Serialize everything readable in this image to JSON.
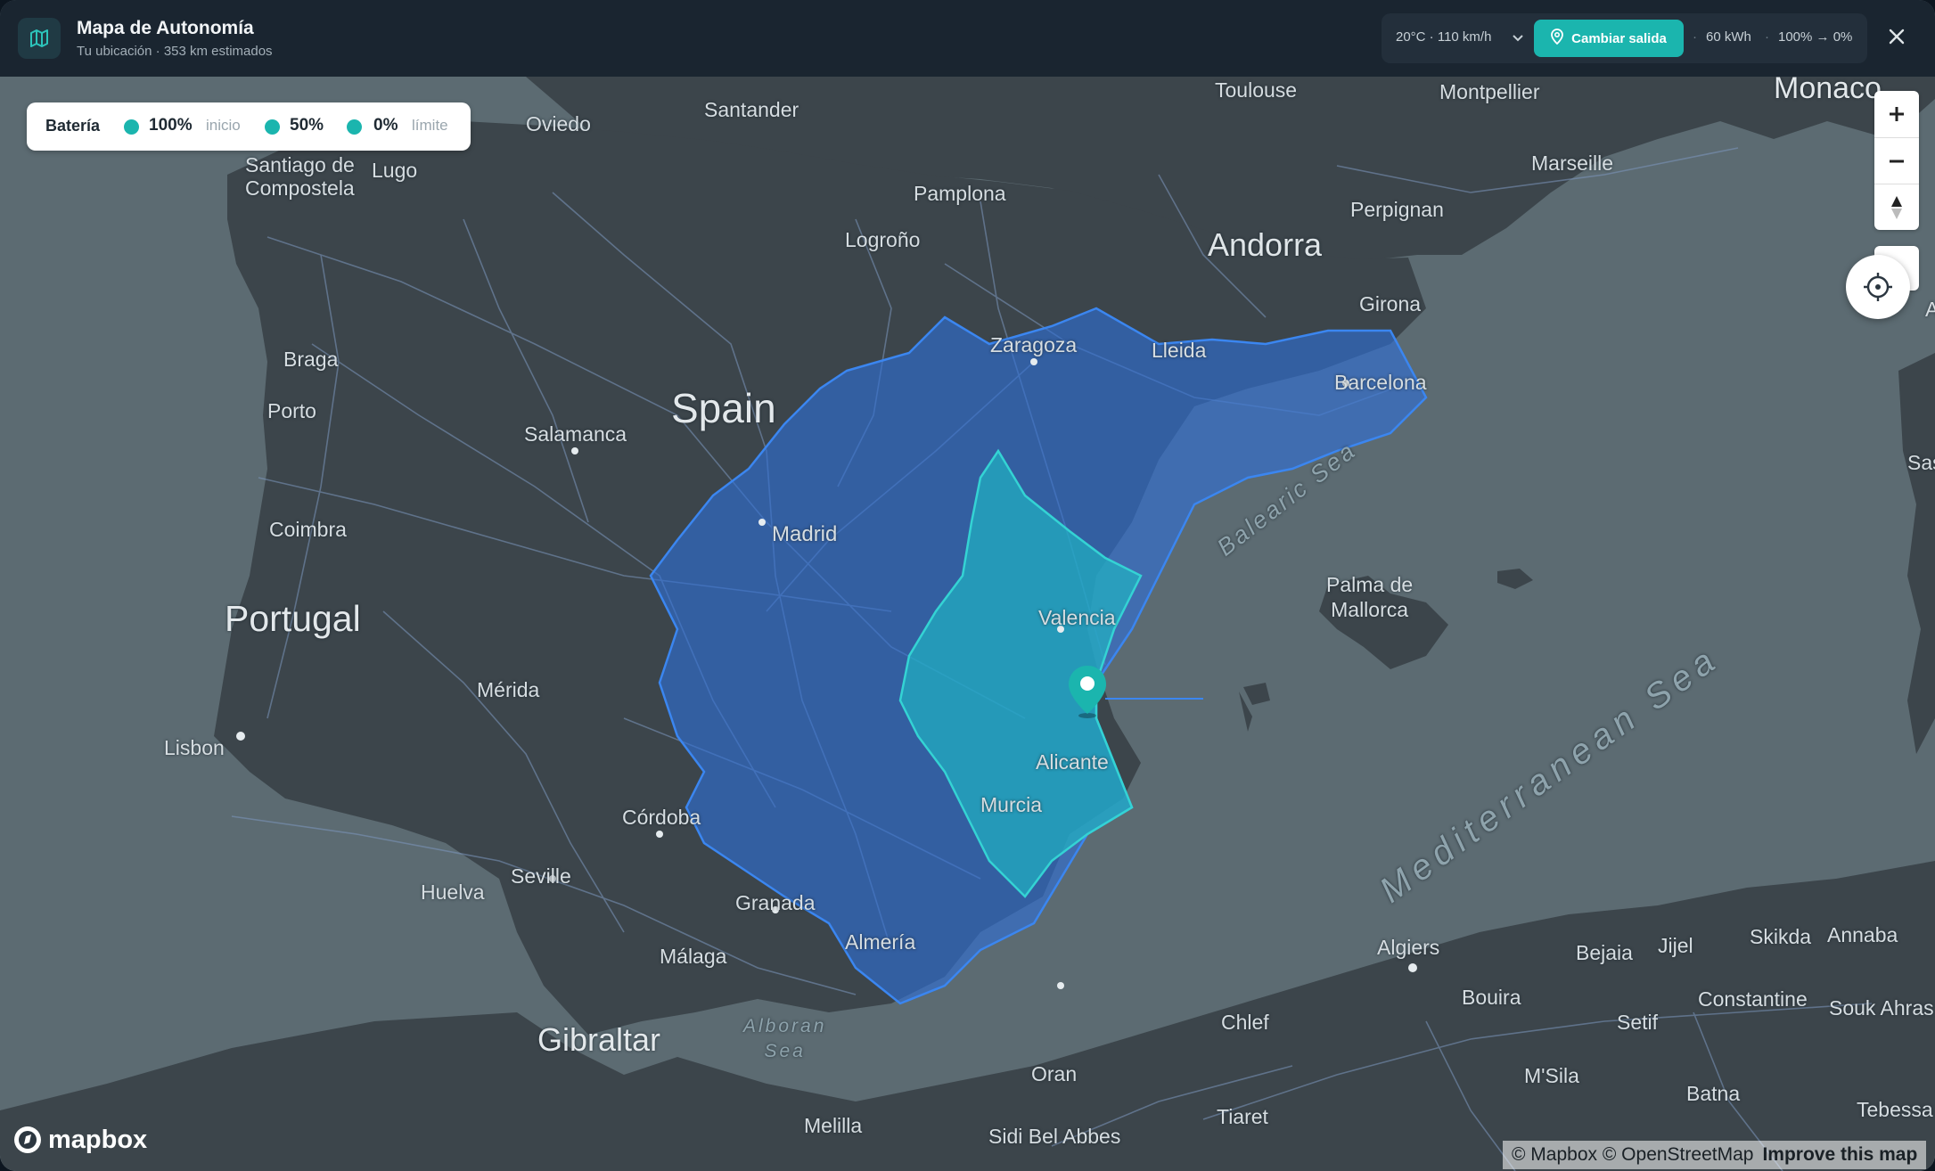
{
  "header": {
    "title": "Mapa de Autonomía",
    "subtitle": "Tu ubicación · 353 km estimados",
    "conditions": "20°C · 110 km/h",
    "change_start_label": "Cambiar salida",
    "battery_capacity": "60 kWh",
    "battery_range": "100% → 0%",
    "separator": "·"
  },
  "legend": {
    "title": "Batería",
    "items": [
      {
        "value": "100%",
        "note": "inicio",
        "color": "#1bb5ae"
      },
      {
        "value": "50%",
        "note": "",
        "color": "#1bb5ae"
      },
      {
        "value": "0%",
        "note": "límite",
        "color": "#1bb5ae"
      }
    ]
  },
  "map": {
    "labels": {
      "santander": "Santander",
      "oviedo": "Oviedo",
      "toulouse": "Toulouse",
      "montpellier": "Montpellier",
      "monaco": "Monaco",
      "santiago": "Santiago de\nCompostela",
      "lugo": "Lugo",
      "pamplona": "Pamplona",
      "marseille": "Marseille",
      "perpignan": "Perpignan",
      "logrono": "Logroño",
      "andorra": "Andorra",
      "girona": "Girona",
      "braga": "Braga",
      "zaragoza": "Zaragoza",
      "lleida": "Lleida",
      "porto": "Porto",
      "spain": "Spain",
      "barcelona": "Barcelona",
      "salamanca": "Salamanca",
      "coimbra": "Coimbra",
      "madrid": "Madrid",
      "balearic": "Balearic Sea",
      "palma": "Palma de\nMallorca",
      "portugal": "Portugal",
      "valencia": "Valencia",
      "merida": "Mérida",
      "lisbon": "Lisbon",
      "alicante": "Alicante",
      "murcia": "Murcia",
      "cordoba": "Córdoba",
      "mediterranean": "Mediterranean Sea",
      "huelva": "Huelva",
      "seville": "Seville",
      "granada": "Granada",
      "malaga": "Málaga",
      "almeria": "Almería",
      "algiers": "Algiers",
      "bejaia": "Bejaia",
      "jijel": "Jijel",
      "skikda": "Skikda",
      "annaba": "Annaba",
      "bouira": "Bouira",
      "constantine": "Constantine",
      "soukahras": "Souk Ahras",
      "gibraltar": "Gibraltar",
      "alboran": "Alboran\nSea",
      "chlef": "Chlef",
      "setif": "Setif",
      "oran": "Oran",
      "msila": "M'Sila",
      "tiaret": "Tiaret",
      "batna": "Batna",
      "melilla": "Melilla",
      "sidibelabbes": "Sidi Bel Abbes",
      "tebessa": "Tebessa",
      "sas": "Sas",
      "a": "A"
    },
    "colors": {
      "water": "#5c6b72",
      "land": "#3c454b",
      "range_full": "#2f6fd6",
      "range_half": "#1fb8c4"
    }
  },
  "attribution": {
    "mapbox": "© Mapbox",
    "osm": "© OpenStreetMap",
    "improve": "Improve this map",
    "logo": "mapbox"
  }
}
